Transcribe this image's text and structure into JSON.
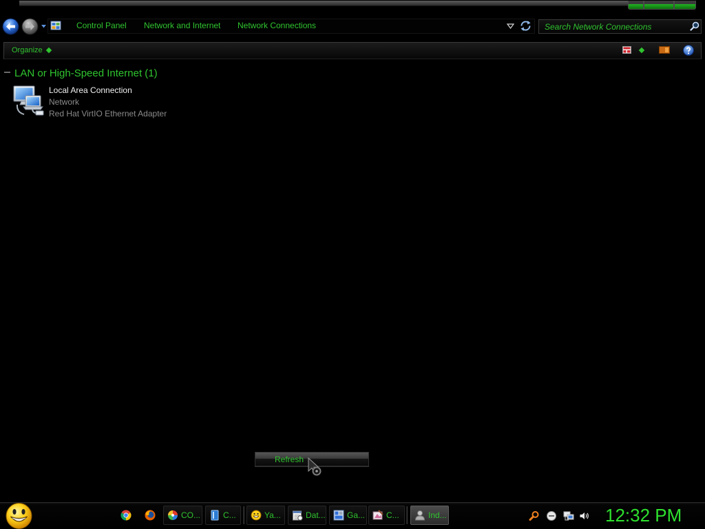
{
  "address_bar": {
    "breadcrumb": [
      "Control Panel",
      "Network and Internet",
      "Network Connections"
    ],
    "location_icon": "control-panel-icon"
  },
  "search": {
    "placeholder": "Search Network Connections",
    "icon": "search-icon"
  },
  "toolbar": {
    "organize_label": "Organize",
    "right_icons": [
      "change-view-icon",
      "view-options-icon",
      "preview-pane-icon",
      "help-icon"
    ]
  },
  "content": {
    "group_title": "LAN or High-Speed Internet (1)",
    "group_expanded": true,
    "connections": [
      {
        "name": "Local Area Connection",
        "status": "Network",
        "device": "Red Hat VirtIO Ethernet Adapter",
        "icon": "network-connection-icon"
      }
    ]
  },
  "context_menu": {
    "items": [
      {
        "label": "Refresh",
        "highlighted": true
      }
    ]
  },
  "taskbar": {
    "start_icon": "smiley-start-icon",
    "quick_launch": [
      "chrome-icon",
      "firefox-icon"
    ],
    "buttons": [
      {
        "label": "CO...",
        "icon": "palette-icon",
        "active": false
      },
      {
        "label": "C...",
        "icon": "book-icon",
        "active": false
      },
      {
        "label": "Ya...",
        "icon": "messenger-smiley-icon",
        "active": false
      },
      {
        "label": "Dat...",
        "icon": "date-time-icon",
        "active": false
      },
      {
        "label": "Ga...",
        "icon": "gadgets-icon",
        "active": false
      },
      {
        "label": "C...",
        "icon": "paint-icon",
        "active": false
      },
      {
        "label": "Ind...",
        "icon": "user-icon",
        "active": true
      }
    ],
    "tray_icons": [
      "search-icon",
      "action-center-icon",
      "network-icon",
      "volume-icon"
    ],
    "clock": "12:32 PM"
  },
  "colors": {
    "background": "#000000",
    "accent_green": "#2fc42f",
    "clock_green": "#2ee02e",
    "text_white": "#f0f0f0",
    "text_gray": "#8a8a8a"
  }
}
